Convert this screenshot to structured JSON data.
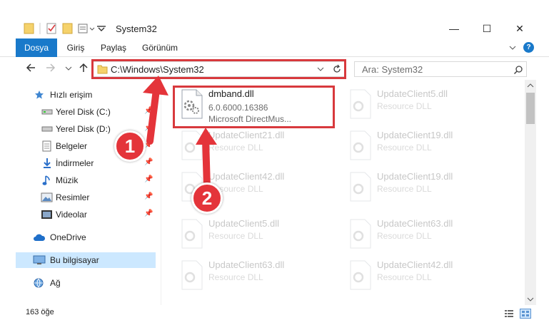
{
  "window": {
    "title": "System32",
    "minimize_glyph": "—",
    "maximize_glyph": "☐",
    "close_glyph": "✕"
  },
  "ribbon": {
    "tabs": [
      {
        "label": "Dosya",
        "active": true
      },
      {
        "label": "Giriş",
        "active": false
      },
      {
        "label": "Paylaş",
        "active": false
      },
      {
        "label": "Görünüm",
        "active": false
      }
    ],
    "help": "?"
  },
  "address": {
    "path": "C:\\Windows\\System32",
    "search_placeholder": "Ara: System32"
  },
  "sidebar": {
    "items": [
      {
        "label": "Hızlı erişim",
        "icon": "star-icon",
        "pinned": false
      },
      {
        "label": "Yerel Disk (C:)",
        "icon": "drive-icon",
        "pinned": true
      },
      {
        "label": "Yerel Disk (D:)",
        "icon": "drive-icon",
        "pinned": true
      },
      {
        "label": "Belgeler",
        "icon": "documents-icon",
        "pinned": true
      },
      {
        "label": "İndirmeler",
        "icon": "download-icon",
        "pinned": true
      },
      {
        "label": "Müzik",
        "icon": "music-icon",
        "pinned": true
      },
      {
        "label": "Resimler",
        "icon": "pictures-icon",
        "pinned": true
      },
      {
        "label": "Videolar",
        "icon": "video-icon",
        "pinned": true
      },
      {
        "label": "OneDrive",
        "icon": "cloud-icon",
        "pinned": false
      },
      {
        "label": "Bu bilgisayar",
        "icon": "computer-icon",
        "pinned": false
      },
      {
        "label": "Ağ",
        "icon": "network-icon",
        "pinned": false
      }
    ]
  },
  "files": {
    "highlighted": {
      "name": "dmband.dll",
      "version": "6.0.6000.16386",
      "description": "Microsoft DirectMus..."
    },
    "faded": [
      {
        "name": "UpdateClient5.dll",
        "type": "Resource DLL"
      },
      {
        "name": "UpdateClient21.dll",
        "type": "Resource DLL"
      },
      {
        "name": "UpdateClient19.dll",
        "type": "Resource DLL"
      },
      {
        "name": "UpdateClient42.dll",
        "type": "Resource DLL"
      },
      {
        "name": "UpdateClient19.dll",
        "type": "Resource DLL"
      },
      {
        "name": "UpdateClient5.dll",
        "type": "Resource DLL"
      },
      {
        "name": "UpdateClient63.dll",
        "type": "Resource DLL"
      },
      {
        "name": "UpdateClient63.dll",
        "type": "Resource DLL"
      },
      {
        "name": "UpdateClient42.dll",
        "type": "Resource DLL"
      }
    ]
  },
  "status": {
    "item_count": "163 öğe"
  },
  "annotations": {
    "badge_1": "1",
    "badge_2": "2",
    "color": "#e4343a"
  }
}
